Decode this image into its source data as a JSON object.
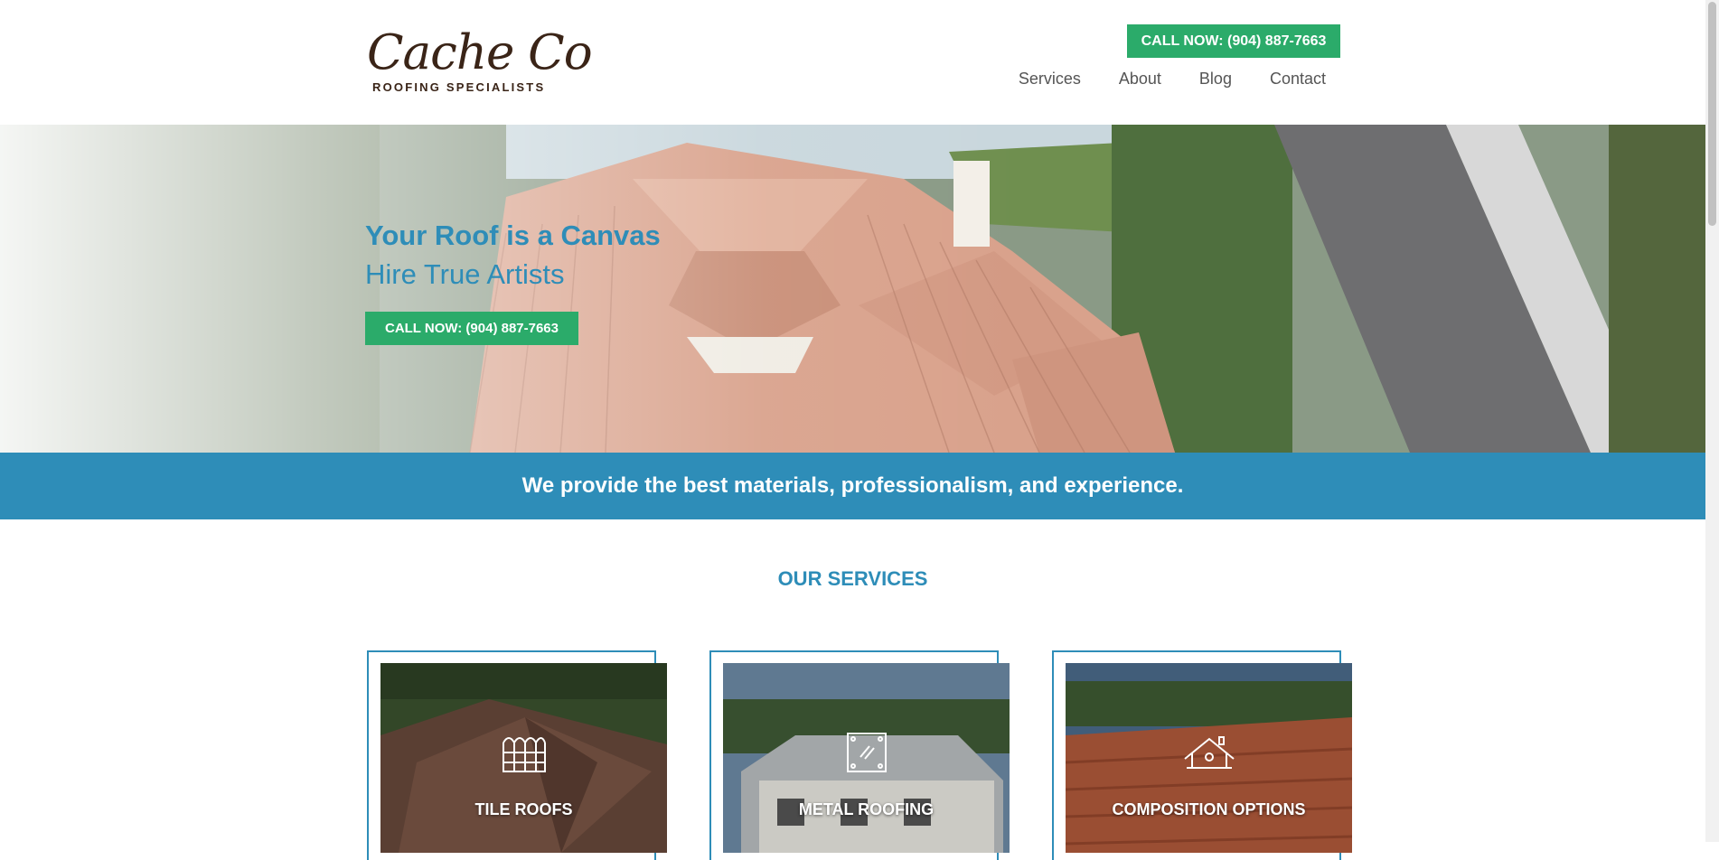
{
  "header": {
    "logo_script": "Cache Co",
    "logo_sub": "ROOFING SPECIALISTS",
    "call_label": "CALL NOW: (904) 887-7663",
    "nav": [
      "Services",
      "About",
      "Blog",
      "Contact"
    ]
  },
  "hero": {
    "title": "Your Roof is a Canvas",
    "subtitle": "Hire True Artists",
    "call_label": "CALL NOW: (904) 887-7663"
  },
  "banner": {
    "text": "We provide the best materials, professionalism, and experience."
  },
  "services": {
    "title": "OUR SERVICES",
    "cards": [
      {
        "label": "TILE ROOFS",
        "icon": "tile-icon"
      },
      {
        "label": "METAL ROOFING",
        "icon": "metal-panel-icon"
      },
      {
        "label": "COMPOSITION OPTIONS",
        "icon": "house-roof-icon"
      }
    ]
  },
  "colors": {
    "accent": "#2e8db8",
    "cta": "#2bab6a",
    "brand_brown": "#3a2417"
  }
}
